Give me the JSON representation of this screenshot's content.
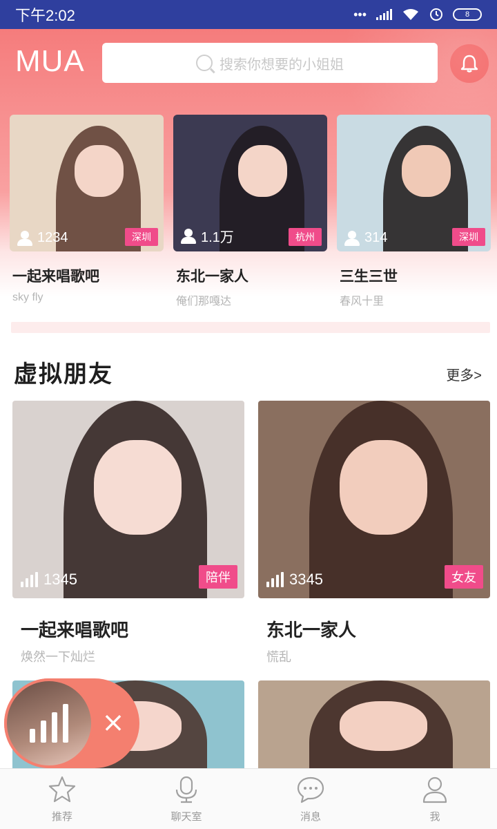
{
  "status_bar": {
    "time": "下午2:02",
    "battery": "8"
  },
  "header": {
    "logo": "MUA",
    "search_placeholder": "搜索你想要的小姐姐",
    "bell_icon": "bell-icon"
  },
  "top_cards": [
    {
      "title": "一起来唱歌吧",
      "subtitle": "sky fly",
      "count": "1234",
      "city": "深圳",
      "bg": "#e8d7c5"
    },
    {
      "title": "东北一家人",
      "subtitle": "俺们那嘎达",
      "count": "1.1万",
      "city": "杭州",
      "bg": "#3c3a52"
    },
    {
      "title": "三生三世",
      "subtitle": "春风十里",
      "count": "314",
      "city": "深圳",
      "bg": "#c9dbe3"
    }
  ],
  "section": {
    "title": "虚拟朋友",
    "more": "更多>"
  },
  "friend_cards": [
    {
      "title": "一起来唱歌吧",
      "subtitle": "焕然一下灿烂",
      "listeners": "1345",
      "tag": "陪伴",
      "bg": "#d9d2cf"
    },
    {
      "title": "东北一家人",
      "subtitle": "慌乱",
      "listeners": "3345",
      "tag": "女友",
      "bg": "#8a6f5f"
    }
  ],
  "friend_cards_row2": [
    {
      "bg": "#8fc3cf"
    },
    {
      "bg": "#b9a38f"
    }
  ],
  "floating_player": {
    "close": "×"
  },
  "bottom_nav": [
    {
      "label": "推荐",
      "icon": "star-icon"
    },
    {
      "label": "聊天室",
      "icon": "microphone-icon"
    },
    {
      "label": "消息",
      "icon": "message-bubble-icon"
    },
    {
      "label": "我",
      "icon": "user-icon"
    }
  ],
  "colors": {
    "accent_pink": "#f04c8a",
    "header_coral": "#f57c7c",
    "status_blue": "#2f3f9e"
  }
}
